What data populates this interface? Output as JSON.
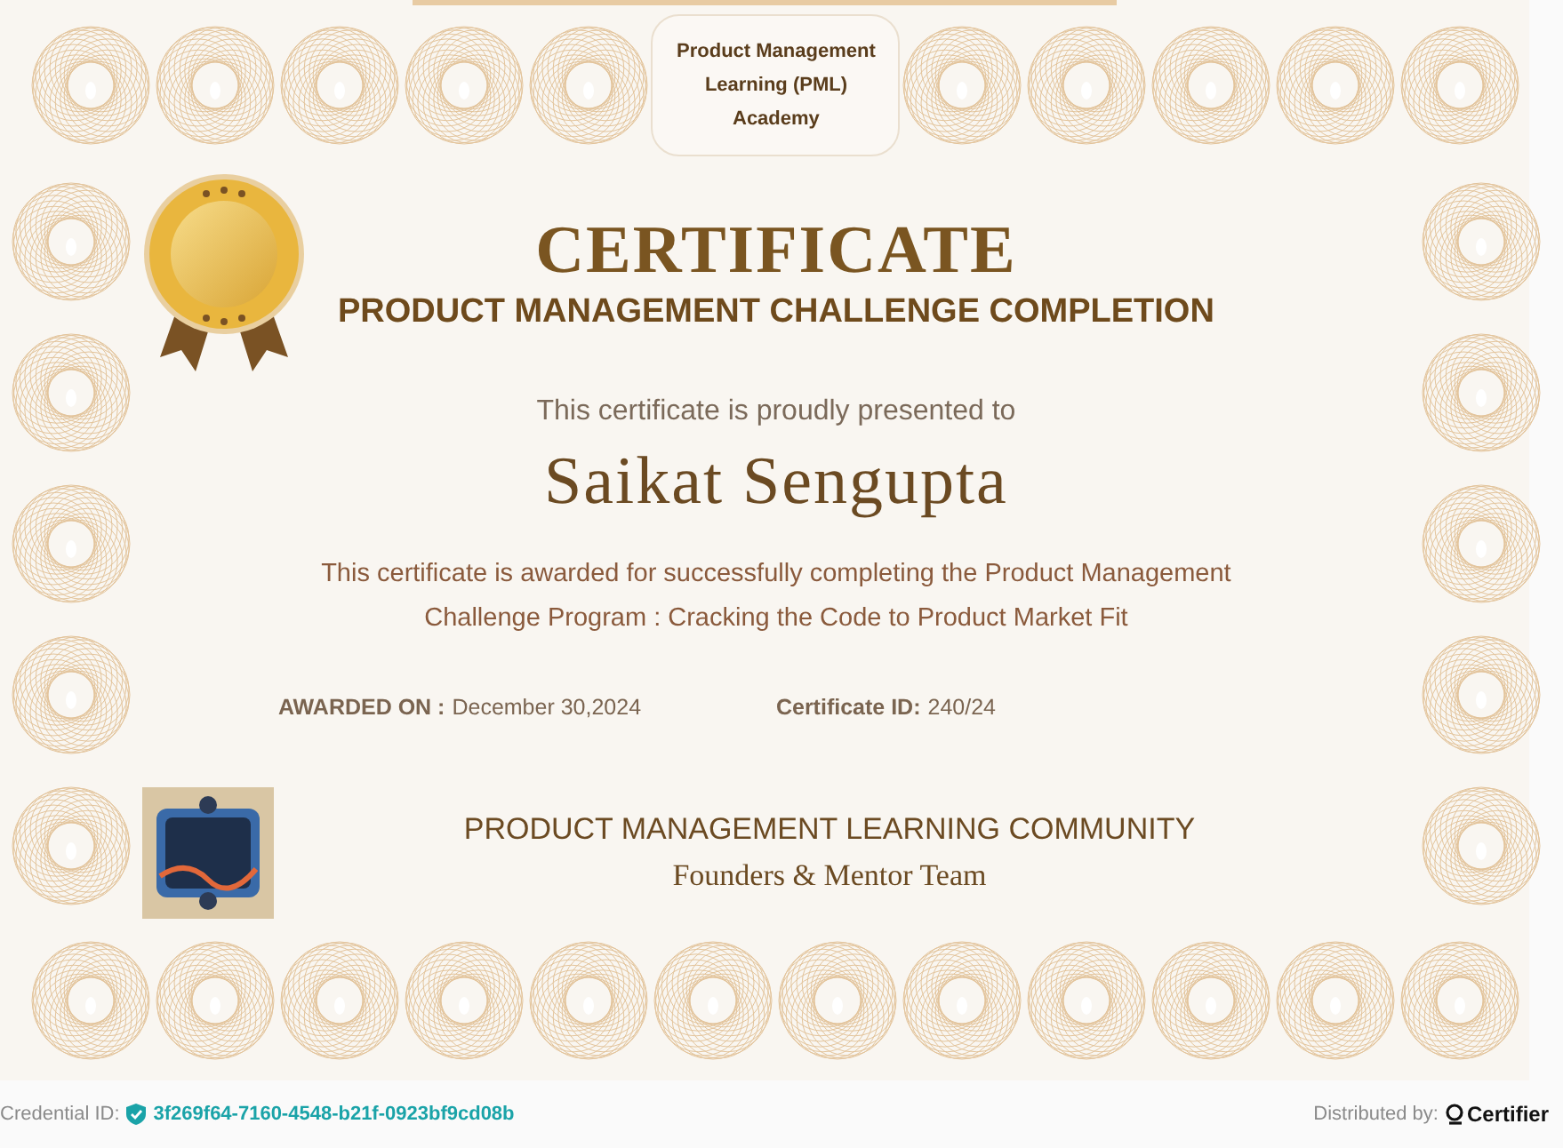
{
  "header": {
    "academy": "Product Management Learning (PML) Academy"
  },
  "certificate": {
    "title": "CERTIFICATE",
    "subtitle": "PRODUCT MANAGEMENT CHALLENGE COMPLETION",
    "presented_to": "This certificate is proudly presented to",
    "recipient": "Saikat Sengupta",
    "description": "This certificate is awarded for successfully completing the Product Management Challenge Program : Cracking the Code to Product Market Fit",
    "awarded_on": {
      "label": "AWARDED ON :",
      "value": "December 30,2024"
    },
    "certificate_id": {
      "label": "Certificate ID:",
      "value": "240/24"
    },
    "issuer": "PRODUCT MANAGEMENT LEARNING COMMUNITY",
    "signatory": "Founders & Mentor Team"
  },
  "footer": {
    "credential_label": "Credential ID:",
    "credential_id": "3f269f64-7160-4548-b21f-0923bf9cd08b",
    "distributed_by": "Distributed by:",
    "brand": "Certifier"
  }
}
